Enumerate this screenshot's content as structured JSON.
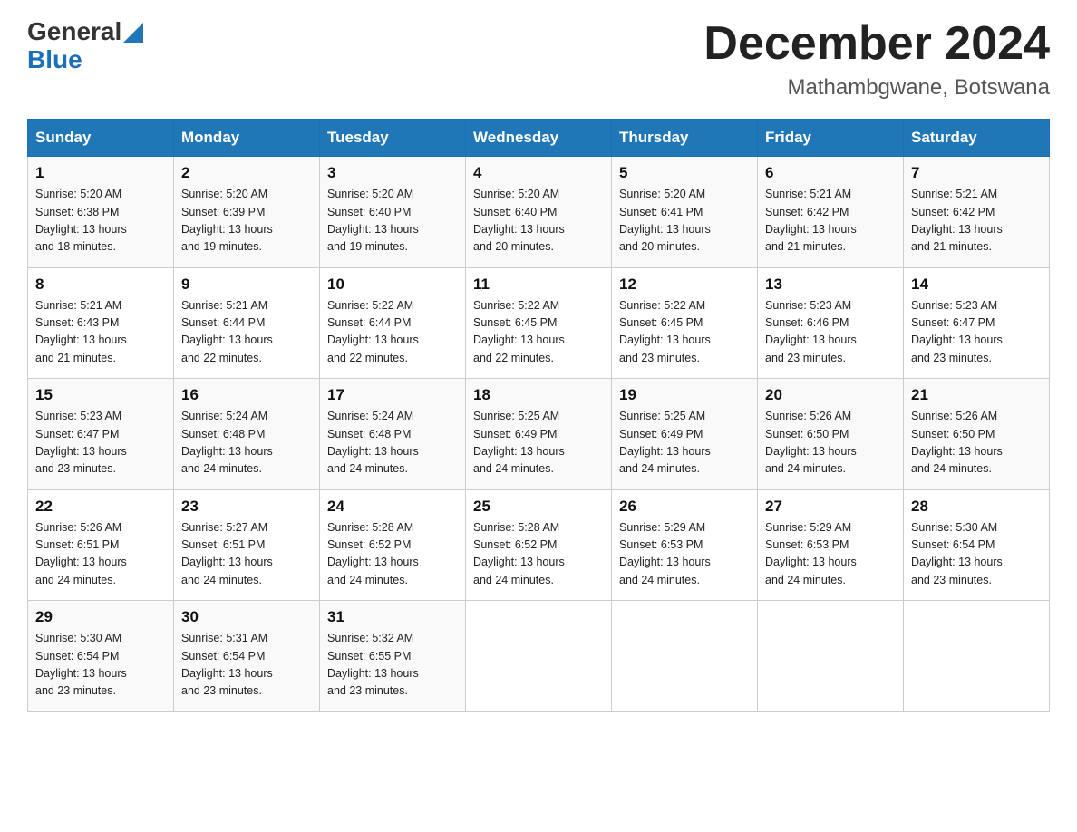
{
  "logo": {
    "text_general": "General",
    "text_blue": "Blue",
    "aria": "GeneralBlue logo"
  },
  "title": "December 2024",
  "subtitle": "Mathambgwane, Botswana",
  "headers": [
    "Sunday",
    "Monday",
    "Tuesday",
    "Wednesday",
    "Thursday",
    "Friday",
    "Saturday"
  ],
  "weeks": [
    [
      {
        "day": "1",
        "info": "Sunrise: 5:20 AM\nSunset: 6:38 PM\nDaylight: 13 hours\nand 18 minutes."
      },
      {
        "day": "2",
        "info": "Sunrise: 5:20 AM\nSunset: 6:39 PM\nDaylight: 13 hours\nand 19 minutes."
      },
      {
        "day": "3",
        "info": "Sunrise: 5:20 AM\nSunset: 6:40 PM\nDaylight: 13 hours\nand 19 minutes."
      },
      {
        "day": "4",
        "info": "Sunrise: 5:20 AM\nSunset: 6:40 PM\nDaylight: 13 hours\nand 20 minutes."
      },
      {
        "day": "5",
        "info": "Sunrise: 5:20 AM\nSunset: 6:41 PM\nDaylight: 13 hours\nand 20 minutes."
      },
      {
        "day": "6",
        "info": "Sunrise: 5:21 AM\nSunset: 6:42 PM\nDaylight: 13 hours\nand 21 minutes."
      },
      {
        "day": "7",
        "info": "Sunrise: 5:21 AM\nSunset: 6:42 PM\nDaylight: 13 hours\nand 21 minutes."
      }
    ],
    [
      {
        "day": "8",
        "info": "Sunrise: 5:21 AM\nSunset: 6:43 PM\nDaylight: 13 hours\nand 21 minutes."
      },
      {
        "day": "9",
        "info": "Sunrise: 5:21 AM\nSunset: 6:44 PM\nDaylight: 13 hours\nand 22 minutes."
      },
      {
        "day": "10",
        "info": "Sunrise: 5:22 AM\nSunset: 6:44 PM\nDaylight: 13 hours\nand 22 minutes."
      },
      {
        "day": "11",
        "info": "Sunrise: 5:22 AM\nSunset: 6:45 PM\nDaylight: 13 hours\nand 22 minutes."
      },
      {
        "day": "12",
        "info": "Sunrise: 5:22 AM\nSunset: 6:45 PM\nDaylight: 13 hours\nand 23 minutes."
      },
      {
        "day": "13",
        "info": "Sunrise: 5:23 AM\nSunset: 6:46 PM\nDaylight: 13 hours\nand 23 minutes."
      },
      {
        "day": "14",
        "info": "Sunrise: 5:23 AM\nSunset: 6:47 PM\nDaylight: 13 hours\nand 23 minutes."
      }
    ],
    [
      {
        "day": "15",
        "info": "Sunrise: 5:23 AM\nSunset: 6:47 PM\nDaylight: 13 hours\nand 23 minutes."
      },
      {
        "day": "16",
        "info": "Sunrise: 5:24 AM\nSunset: 6:48 PM\nDaylight: 13 hours\nand 24 minutes."
      },
      {
        "day": "17",
        "info": "Sunrise: 5:24 AM\nSunset: 6:48 PM\nDaylight: 13 hours\nand 24 minutes."
      },
      {
        "day": "18",
        "info": "Sunrise: 5:25 AM\nSunset: 6:49 PM\nDaylight: 13 hours\nand 24 minutes."
      },
      {
        "day": "19",
        "info": "Sunrise: 5:25 AM\nSunset: 6:49 PM\nDaylight: 13 hours\nand 24 minutes."
      },
      {
        "day": "20",
        "info": "Sunrise: 5:26 AM\nSunset: 6:50 PM\nDaylight: 13 hours\nand 24 minutes."
      },
      {
        "day": "21",
        "info": "Sunrise: 5:26 AM\nSunset: 6:50 PM\nDaylight: 13 hours\nand 24 minutes."
      }
    ],
    [
      {
        "day": "22",
        "info": "Sunrise: 5:26 AM\nSunset: 6:51 PM\nDaylight: 13 hours\nand 24 minutes."
      },
      {
        "day": "23",
        "info": "Sunrise: 5:27 AM\nSunset: 6:51 PM\nDaylight: 13 hours\nand 24 minutes."
      },
      {
        "day": "24",
        "info": "Sunrise: 5:28 AM\nSunset: 6:52 PM\nDaylight: 13 hours\nand 24 minutes."
      },
      {
        "day": "25",
        "info": "Sunrise: 5:28 AM\nSunset: 6:52 PM\nDaylight: 13 hours\nand 24 minutes."
      },
      {
        "day": "26",
        "info": "Sunrise: 5:29 AM\nSunset: 6:53 PM\nDaylight: 13 hours\nand 24 minutes."
      },
      {
        "day": "27",
        "info": "Sunrise: 5:29 AM\nSunset: 6:53 PM\nDaylight: 13 hours\nand 24 minutes."
      },
      {
        "day": "28",
        "info": "Sunrise: 5:30 AM\nSunset: 6:54 PM\nDaylight: 13 hours\nand 23 minutes."
      }
    ],
    [
      {
        "day": "29",
        "info": "Sunrise: 5:30 AM\nSunset: 6:54 PM\nDaylight: 13 hours\nand 23 minutes."
      },
      {
        "day": "30",
        "info": "Sunrise: 5:31 AM\nSunset: 6:54 PM\nDaylight: 13 hours\nand 23 minutes."
      },
      {
        "day": "31",
        "info": "Sunrise: 5:32 AM\nSunset: 6:55 PM\nDaylight: 13 hours\nand 23 minutes."
      },
      {
        "day": "",
        "info": ""
      },
      {
        "day": "",
        "info": ""
      },
      {
        "day": "",
        "info": ""
      },
      {
        "day": "",
        "info": ""
      }
    ]
  ]
}
